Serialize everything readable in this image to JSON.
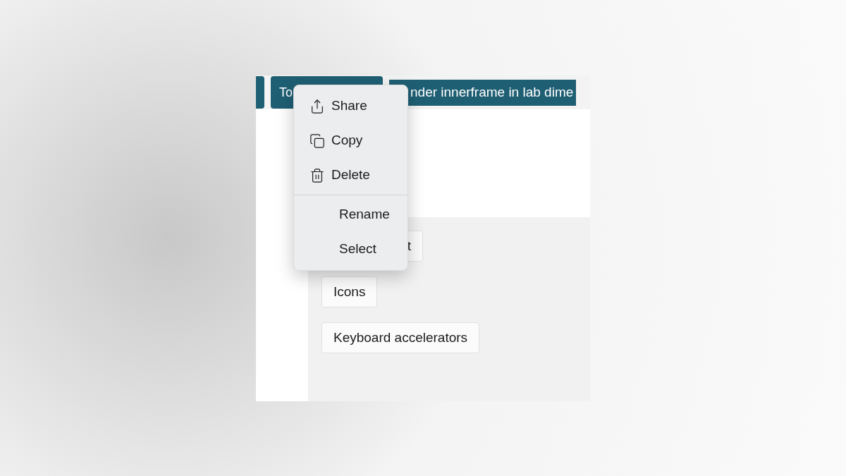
{
  "top_bar": {
    "buttons": [
      {
        "kind": "stub"
      },
      {
        "kind": "text",
        "label": "To"
      },
      {
        "kind": "text",
        "label": "nder innerframe in lab dime"
      }
    ]
  },
  "content_buttons": [
    {
      "label": "t"
    },
    {
      "label": "Icons"
    },
    {
      "label": "Keyboard accelerators"
    }
  ],
  "context_menu": {
    "items": [
      {
        "kind": "share",
        "label": "Share"
      },
      {
        "kind": "copy",
        "label": "Copy"
      },
      {
        "kind": "delete",
        "label": "Delete"
      },
      {
        "kind": "separator"
      },
      {
        "kind": "plain",
        "label": "Rename"
      },
      {
        "kind": "plain",
        "label": "Select"
      }
    ]
  }
}
